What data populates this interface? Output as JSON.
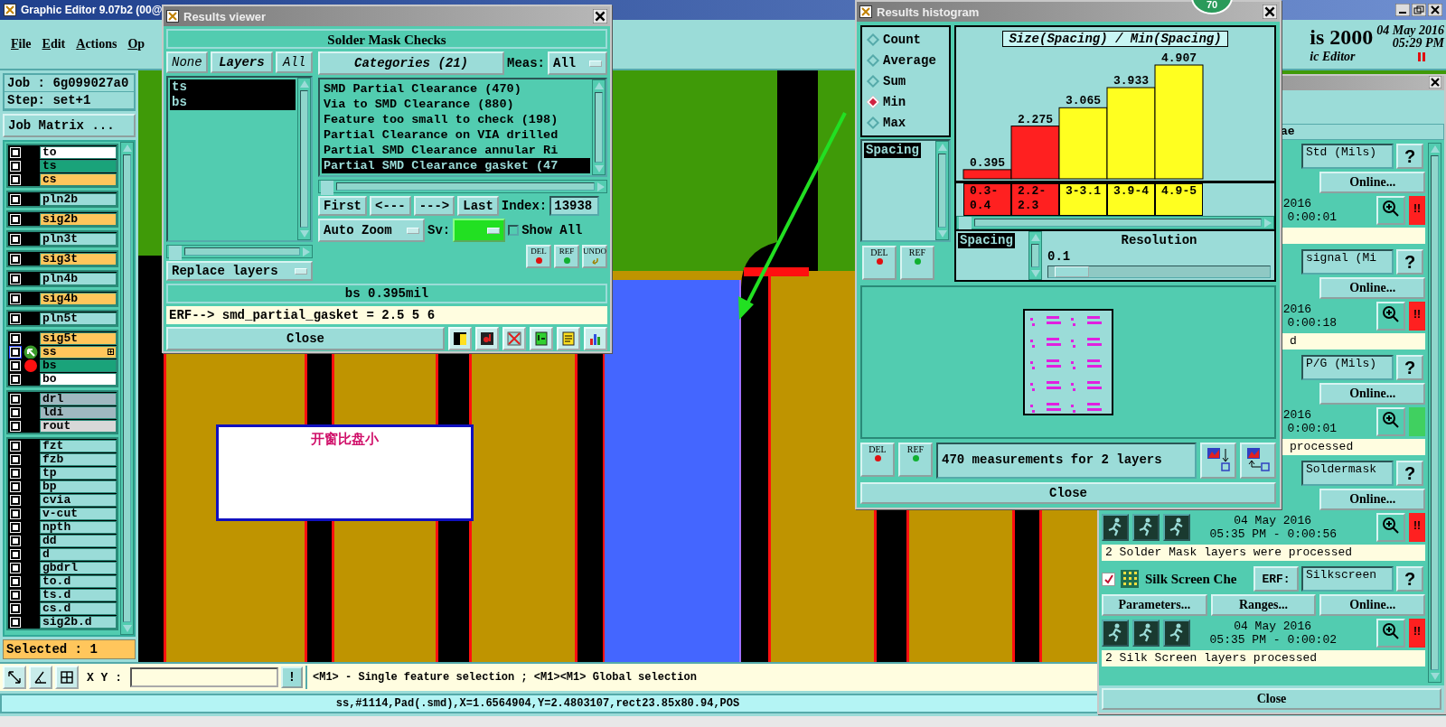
{
  "main_window": {
    "title": "Graphic Editor 9.07b2 (00@",
    "menu": [
      "File",
      "Edit",
      "Actions",
      "Op"
    ]
  },
  "header": {
    "product": "is 2000",
    "subtitle": "ic Editor",
    "date": "04 May 2016",
    "time": "05:29 PM"
  },
  "job": {
    "job": "Job : 6g099027a0",
    "step": "Step: set+1",
    "matrix_button": "Job Matrix ..."
  },
  "layer_groups": [
    {
      "layers": [
        {
          "name": "to",
          "color": "#ffffff",
          "checked": false,
          "selected": false
        },
        {
          "name": "ts",
          "color": "#1aa37a",
          "checked": false,
          "selected": false
        },
        {
          "name": "cs",
          "color": "#ffc65c",
          "checked": false,
          "selected": false
        }
      ]
    },
    {
      "layers": [
        {
          "name": "pln2b",
          "color": "#9adcd8",
          "checked": false,
          "selected": false
        }
      ]
    },
    {
      "layers": [
        {
          "name": "sig2b",
          "color": "#ffc65c",
          "checked": false,
          "selected": false
        }
      ]
    },
    {
      "layers": [
        {
          "name": "pln3t",
          "color": "#9adcd8",
          "checked": false,
          "selected": false
        }
      ]
    },
    {
      "layers": [
        {
          "name": "sig3t",
          "color": "#ffc65c",
          "checked": false,
          "selected": false
        }
      ]
    },
    {
      "layers": [
        {
          "name": "pln4b",
          "color": "#9adcd8",
          "checked": false,
          "selected": false
        }
      ]
    },
    {
      "layers": [
        {
          "name": "sig4b",
          "color": "#ffc65c",
          "checked": false,
          "selected": false
        }
      ]
    },
    {
      "layers": [
        {
          "name": "pln5t",
          "color": "#9adcd8",
          "checked": false,
          "selected": false
        }
      ]
    },
    {
      "layers": [
        {
          "name": "sig5t",
          "color": "#ffc65c",
          "checked": false,
          "selected": false
        },
        {
          "name": "ss",
          "color": "#ffc65c",
          "checked": false,
          "selected": true,
          "kind": "arrow"
        },
        {
          "name": "bs",
          "color": "#1aa37a",
          "checked": false,
          "selected": false,
          "kind": "dot"
        },
        {
          "name": "bo",
          "color": "#ffffff",
          "checked": false,
          "selected": false
        }
      ]
    },
    {
      "layers": [
        {
          "name": "drl",
          "color": "#a0b8c0",
          "checked": false,
          "selected": false
        },
        {
          "name": "ldi",
          "color": "#a0b8c0",
          "checked": false,
          "selected": false
        },
        {
          "name": "rout",
          "color": "#d8d8d8",
          "checked": false,
          "selected": false
        }
      ]
    },
    {
      "layers": [
        {
          "name": "fzt",
          "color": "#9adcd8",
          "checked": false,
          "selected": false
        },
        {
          "name": "fzb",
          "color": "#9adcd8",
          "checked": false,
          "selected": false
        },
        {
          "name": "tp",
          "color": "#9adcd8",
          "checked": false,
          "selected": false
        },
        {
          "name": "bp",
          "color": "#9adcd8",
          "checked": false,
          "selected": false
        },
        {
          "name": "cvia",
          "color": "#9adcd8",
          "checked": false,
          "selected": false
        },
        {
          "name": "v-cut",
          "color": "#9adcd8",
          "checked": false,
          "selected": false
        },
        {
          "name": "npth",
          "color": "#9adcd8",
          "checked": false,
          "selected": false
        },
        {
          "name": "dd",
          "color": "#9adcd8",
          "checked": false,
          "selected": false
        },
        {
          "name": "d",
          "color": "#9adcd8",
          "checked": false,
          "selected": false
        },
        {
          "name": "gbdrl",
          "color": "#9adcd8",
          "checked": false,
          "selected": false
        },
        {
          "name": "to.d",
          "color": "#9adcd8",
          "checked": false,
          "selected": false
        },
        {
          "name": "ts.d",
          "color": "#9adcd8",
          "checked": false,
          "selected": false
        },
        {
          "name": "cs.d",
          "color": "#9adcd8",
          "checked": false,
          "selected": false
        },
        {
          "name": "sig2b.d",
          "color": "#9adcd8",
          "checked": false,
          "selected": false
        }
      ]
    }
  ],
  "selected_count": "Selected : 1",
  "canvas": {
    "note": "开窗比盘小"
  },
  "xy_bar": {
    "label": "X Y :",
    "button": "!",
    "hint": "<M1> - Single feature selection ; <M1><M1> Global selection"
  },
  "status_bar": "ss,#1114,Pad(.smd),X=1.6564904,Y=2.4803107,rect23.85x80.94,POS",
  "results_viewer": {
    "title": "Results viewer",
    "heading": "Solder Mask Checks",
    "layer_buttons": [
      "None",
      "Layers",
      "All"
    ],
    "layers": [
      {
        "name": "ts",
        "selected": true
      },
      {
        "name": "bs",
        "selected": true
      }
    ],
    "replace": "Replace layers",
    "categories_button": "Categories (21)",
    "meas_label": "Meas:",
    "meas_value": "All",
    "categories": [
      {
        "label": "SMD Partial Clearance (470)",
        "selected": false
      },
      {
        "label": "Via to SMD Clearance (880)",
        "selected": false
      },
      {
        "label": "Feature too small to check (198)",
        "selected": false
      },
      {
        "label": "Partial Clearance on VIA drilled",
        "selected": false
      },
      {
        "label": "Partial SMD Clearance annular Ri",
        "selected": false
      },
      {
        "label": "Partial SMD Clearance gasket (47",
        "selected": true
      }
    ],
    "nav": [
      "First",
      "<---",
      "--->",
      "Last"
    ],
    "index_label": "Index:",
    "index": "13938",
    "zoom": "Auto Zoom",
    "sv_label": "Sv:",
    "show_all": {
      "label": "Show All",
      "checked": false
    },
    "actions": [
      "DEL",
      "REF",
      "UNDO"
    ],
    "measure": "bs 0.395mil",
    "erf": "ERF--> smd_partial_gasket = 2.5 5 6",
    "close": "Close"
  },
  "histogram": {
    "title": "Results histogram",
    "badge": "70",
    "modes": [
      {
        "label": "Count",
        "selected": false
      },
      {
        "label": "Average",
        "selected": false
      },
      {
        "label": "Sum",
        "selected": false
      },
      {
        "label": "Min",
        "selected": true
      },
      {
        "label": "Max",
        "selected": false
      }
    ],
    "fields": [
      {
        "label": "Spacing",
        "selected": true
      }
    ],
    "field_buttons": [
      "DEL",
      "REF"
    ],
    "chart_data": {
      "type": "bar",
      "title": "Size(Spacing) / Min(Spacing)",
      "categories": [
        "0.3-0.4",
        "2.2-2.3",
        "3-3.1",
        "3.9-4",
        "4.9-5"
      ],
      "stacked": true,
      "data_labels": true,
      "series": [
        {
          "color": "#ff2020",
          "values": [
            0.395,
            2.275,
            null,
            null,
            null
          ]
        },
        {
          "color": "#ffff20",
          "values": [
            null,
            null,
            3.065,
            3.933,
            4.907
          ]
        }
      ]
    },
    "fields2": [
      {
        "label": "Spacing",
        "selected": true
      }
    ],
    "resolution": {
      "label": "Resolution",
      "value": "0.1",
      "level": 0.03
    },
    "bottom_buttons": [
      "DEL",
      "REF"
    ],
    "summary": "470 measurements for 2 layers",
    "close": "Close"
  },
  "checks_panel": {
    "header": "ae",
    "close": "Close",
    "blocks": [
      {
        "kind": "side",
        "field": "Std (Mils)",
        "help": "?",
        "buttons": [
          "Online..."
        ],
        "date": "2016",
        "time": "0:00:01",
        "status": {
          "color": "#ff2020",
          "text": "!!"
        }
      },
      {
        "kind": "side",
        "field": "signal (Mi",
        "help": "?",
        "buttons": [
          "Online..."
        ],
        "date": "2016",
        "time": "0:00:18",
        "status": {
          "color": "#ff2020",
          "text": "!!"
        },
        "message": "d"
      },
      {
        "kind": "side",
        "field": "P/G (Mils)",
        "help": "?",
        "buttons": [
          "Online..."
        ],
        "date": "2016",
        "time": "0:00:01",
        "status": {
          "color": "#40d060"
        },
        "message": "processed"
      },
      {
        "kind": "top",
        "field": "Soldermask",
        "help": "?",
        "buttons": [
          "Online..."
        ],
        "date": "04 May 2016",
        "time": "05:35 PM - 0:00:56",
        "status": {
          "color": "#ff2020",
          "text": "!!"
        },
        "message": "2 Solder Mask layers were processed"
      },
      {
        "kind": "full",
        "checked": true,
        "name": "Silk Screen Che",
        "erf": "ERF:",
        "field": "Silkscreen",
        "help": "?",
        "buttons": [
          "Parameters...",
          "Ranges...",
          "Online..."
        ],
        "date": "04 May 2016",
        "time": "05:35 PM - 0:00:02",
        "status": {
          "color": "#ff2020",
          "text": "!!"
        },
        "message": "2 Silk Screen layers processed"
      }
    ]
  }
}
